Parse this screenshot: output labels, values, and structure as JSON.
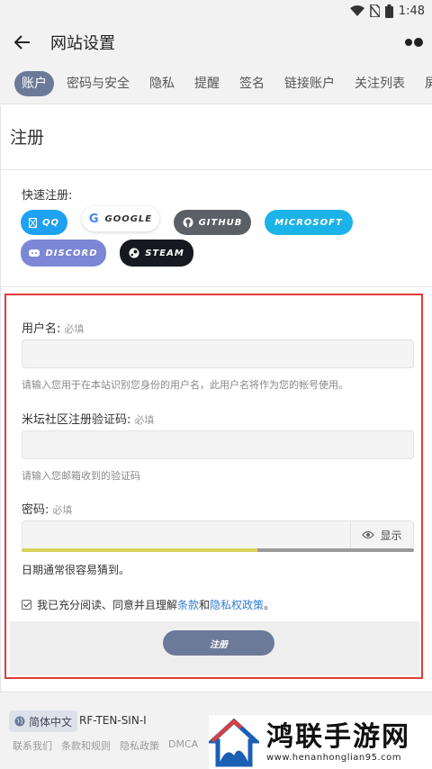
{
  "status_bar": {
    "time": "1:48"
  },
  "app_bar": {
    "title": "网站设置"
  },
  "tabs": [
    {
      "label": "账户",
      "active": true
    },
    {
      "label": "密码与安全"
    },
    {
      "label": "隐私"
    },
    {
      "label": "提醒"
    },
    {
      "label": "签名"
    },
    {
      "label": "链接账户"
    },
    {
      "label": "关注列表"
    },
    {
      "label": "屏蔽"
    }
  ],
  "page": {
    "heading": "注册",
    "quick_label": "快速注册:"
  },
  "social": {
    "qq": "QQ",
    "google": "GOOGLE",
    "github": "GITHUB",
    "microsoft": "MICROSOFT",
    "discord": "DISCORD",
    "steam": "STEAM"
  },
  "form": {
    "username_label": "用户名:",
    "username_req": "必填",
    "username_hint": "请输入您用于在本站识别您身份的用户名，此用户名将作为您的帐号使用。",
    "code_label": "米坛社区注册验证码:",
    "code_req": "必填",
    "code_hint": "请输入您邮箱收到的验证码",
    "password_label": "密码:",
    "password_req": "必填",
    "show_label": "显示",
    "strength_fraction": 0.6,
    "strength_text": "日期通常很容易猜到。",
    "agree_prefix": "我已充分阅读、同意并且理解",
    "agree_terms": "条款",
    "agree_and": "和",
    "agree_privacy": "隐私权政策",
    "agree_suffix": "。",
    "submit_label": "注册"
  },
  "footer": {
    "lang": "简体中文",
    "server_code": "RF-TEN-SIN-I",
    "links": [
      "联系我们",
      "条款和规则",
      "隐私政策",
      "DMCA"
    ]
  },
  "watermark": {
    "title": "鸿联手游网",
    "url": "www.henanhonglian95.com"
  },
  "colors": {
    "accent": "#6b7a99",
    "highlight_border": "#e23b3b",
    "link": "#2f7fd6"
  }
}
